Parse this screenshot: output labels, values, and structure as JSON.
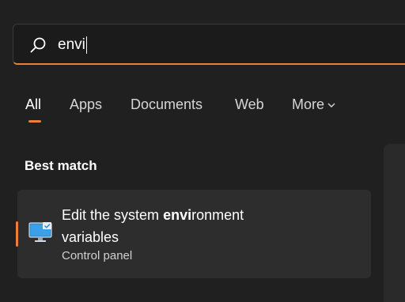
{
  "search": {
    "query": "envi",
    "icon": "search-icon"
  },
  "tabs": [
    {
      "label": "All",
      "active": true
    },
    {
      "label": "Apps"
    },
    {
      "label": "Documents"
    },
    {
      "label": "Web"
    },
    {
      "label": "More"
    }
  ],
  "best_match": {
    "section_title": "Best match",
    "result": {
      "title_prefix": "Edit the system ",
      "title_match": "envi",
      "title_suffix_line1": "ronment",
      "title_line2": "variables",
      "subtitle": "Control panel",
      "icon": "monitor-settings-icon"
    }
  },
  "colors": {
    "accent": "#e8823a",
    "background": "#202020",
    "card": "#2d2d2d"
  }
}
